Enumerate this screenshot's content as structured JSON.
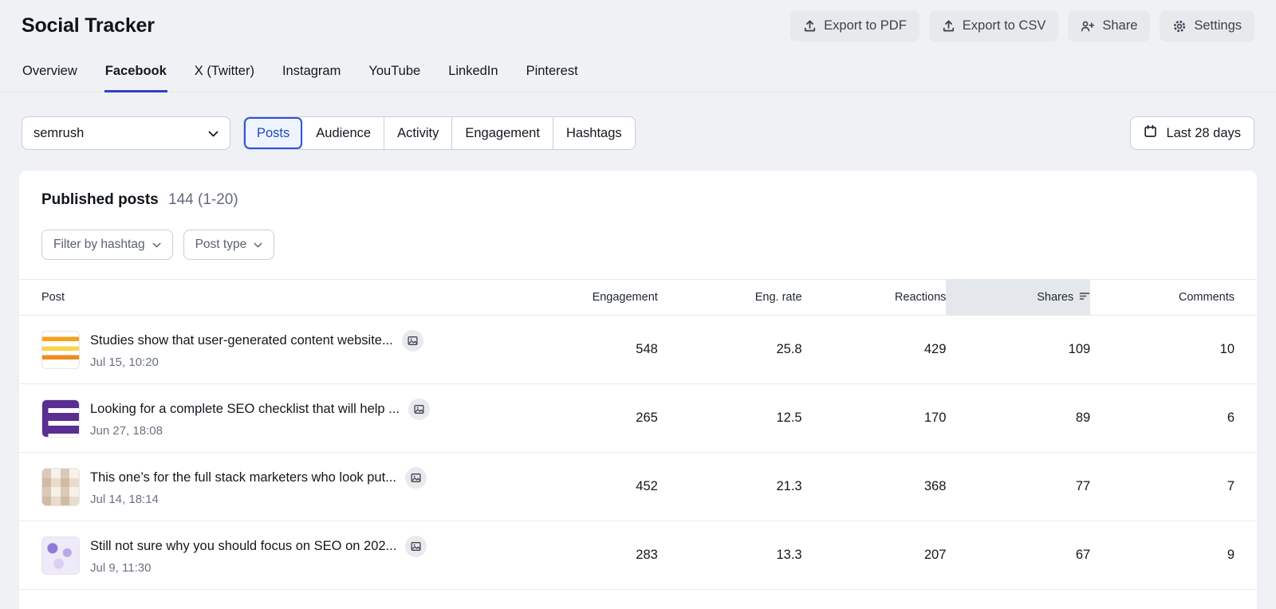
{
  "theme": {
    "page_bg": "#f0f1f4",
    "tab_underline": "#3142c4",
    "segment_active_border": "#2d54d8",
    "segment_active_bg": "#eef3fe",
    "sorted_header_bg": "#e4e7ec",
    "header_button_bg": "#e7e9ed"
  },
  "header": {
    "title": "Social Tracker",
    "actions": [
      {
        "label": "Export to PDF",
        "icon": "export-icon"
      },
      {
        "label": "Export to CSV",
        "icon": "export-icon"
      },
      {
        "label": "Share",
        "icon": "share-icon"
      },
      {
        "label": "Settings",
        "icon": "gear-icon"
      }
    ]
  },
  "tabs": [
    {
      "label": "Overview",
      "active": false
    },
    {
      "label": "Facebook",
      "active": true
    },
    {
      "label": "X (Twitter)",
      "active": false
    },
    {
      "label": "Instagram",
      "active": false
    },
    {
      "label": "YouTube",
      "active": false
    },
    {
      "label": "LinkedIn",
      "active": false
    },
    {
      "label": "Pinterest",
      "active": false
    }
  ],
  "controls": {
    "profile_select": {
      "value": "semrush"
    },
    "segments": [
      {
        "label": "Posts",
        "active": true
      },
      {
        "label": "Audience",
        "active": false
      },
      {
        "label": "Activity",
        "active": false
      },
      {
        "label": "Engagement",
        "active": false
      },
      {
        "label": "Hashtags",
        "active": false
      }
    ],
    "date_range_label": "Last 28 days"
  },
  "published": {
    "title": "Published posts",
    "count": "144 (1-20)",
    "filters": [
      {
        "label": "Filter by hashtag"
      },
      {
        "label": "Post type"
      }
    ]
  },
  "table": {
    "columns": {
      "post": "Post",
      "engagement": "Engagement",
      "eng_rate": "Eng. rate",
      "reactions": "Reactions",
      "shares": "Shares",
      "comments": "Comments"
    },
    "sorted_by": "Shares",
    "sort_direction": "descending",
    "rows": [
      {
        "title": "Studies show that user-generated content website...",
        "date": "Jul 15, 10:20",
        "engagement": "548",
        "eng_rate": "25.8",
        "reactions": "429",
        "shares": "109",
        "comments": "10"
      },
      {
        "title": "Looking for a complete SEO checklist that will help ...",
        "date": "Jun 27, 18:08",
        "engagement": "265",
        "eng_rate": "12.5",
        "reactions": "170",
        "shares": "89",
        "comments": "6"
      },
      {
        "title": "This one’s for the full stack marketers who look put...",
        "date": "Jul 14, 18:14",
        "engagement": "452",
        "eng_rate": "21.3",
        "reactions": "368",
        "shares": "77",
        "comments": "7"
      },
      {
        "title": "Still not sure why you should focus on SEO on 202...",
        "date": "Jul 9, 11:30",
        "engagement": "283",
        "eng_rate": "13.3",
        "reactions": "207",
        "shares": "67",
        "comments": "9"
      }
    ]
  }
}
